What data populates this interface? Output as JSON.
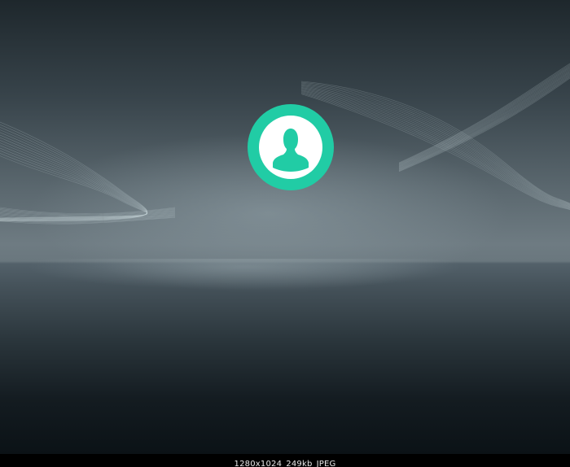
{
  "image_viewer": {
    "status": {
      "dimensions": "1280x1024",
      "size": "249kb",
      "format": "JPEG"
    }
  },
  "wallpaper": {
    "avatar": {
      "icon": "user-silhouette-icon",
      "ring_color": "#21cca5",
      "inner_color": "#ffffff"
    }
  }
}
